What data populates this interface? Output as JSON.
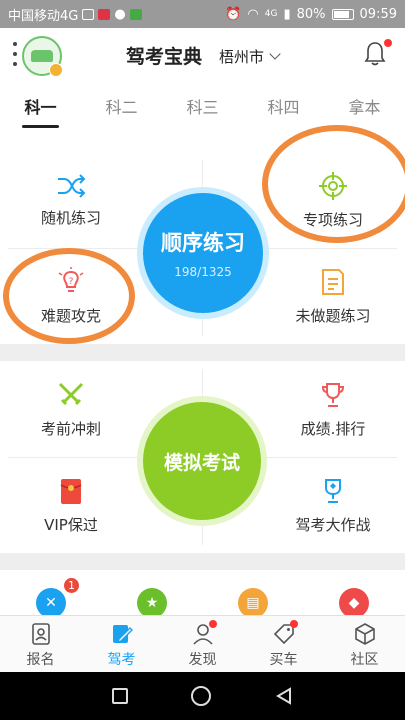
{
  "status_bar": {
    "carrier": "中国移动4G",
    "signal": "4G",
    "battery": "80%",
    "time": "09:59"
  },
  "header": {
    "title": "驾考宝典",
    "city": "梧州市"
  },
  "tabs": [
    "科一",
    "科二",
    "科三",
    "科四",
    "拿本"
  ],
  "practice": {
    "random": "随机练习",
    "special": "专项练习",
    "hard": "难题攻克",
    "undone": "未做题练习",
    "sequence_label": "顺序练习",
    "progress": "198/1325",
    "progress_done": 198,
    "progress_total": 1325
  },
  "exam": {
    "sprint": "考前冲刺",
    "ranking": "成绩.排行",
    "vip": "VIP保过",
    "battle": "驾考大作战",
    "mock_label": "模拟考试"
  },
  "strip": {
    "badge_count": "1"
  },
  "bottom_nav": [
    "报名",
    "驾考",
    "发现",
    "买车",
    "社区"
  ],
  "colors": {
    "blue": "#1aa2f0",
    "green": "#8dcc26",
    "annotation_orange": "#f08a3c"
  }
}
